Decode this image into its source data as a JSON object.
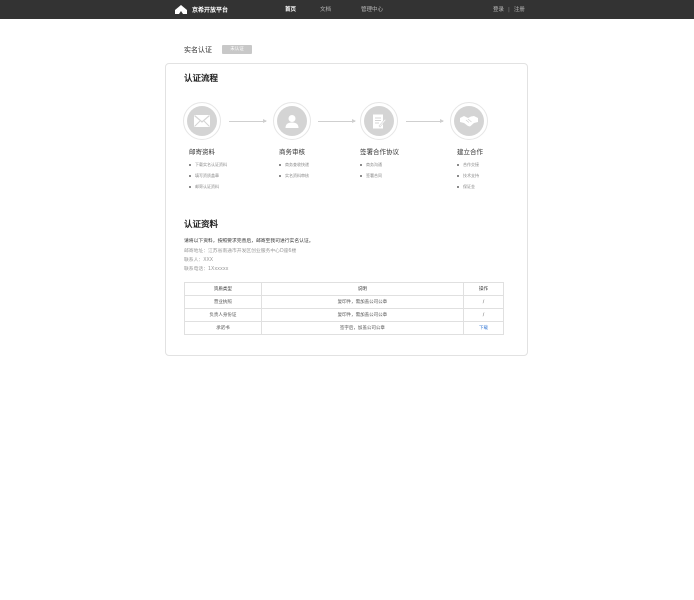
{
  "header": {
    "brand": "京希开放平台",
    "nav": [
      "首页",
      "文档",
      "管理中心"
    ],
    "active_nav": "首页",
    "login": "登录",
    "register": "注册"
  },
  "page": {
    "title": "实名认证",
    "status": "未认证"
  },
  "process": {
    "title": "认证流程",
    "steps": [
      {
        "title": "邮寄资料",
        "icon": "envelope-icon",
        "items": [
          "下载实名认证资料",
          "填写资质盖章",
          "邮寄认证资料"
        ]
      },
      {
        "title": "商务审核",
        "icon": "user-icon",
        "items": [
          "商务查收快递",
          "实名资料审核"
        ]
      },
      {
        "title": "签署合作协议",
        "icon": "contract-icon",
        "items": [
          "商务沟通",
          "签署合同"
        ]
      },
      {
        "title": "建立合作",
        "icon": "handshake-icon",
        "items": [
          "合作交接",
          "技术支持",
          "保证金"
        ]
      }
    ]
  },
  "materials": {
    "title": "认证资料",
    "intro": "请将以下资料，按照要求完善后，邮寄至我司进行实名认证。",
    "address": "邮寄地址：江苏省南通市开发区创业服务中心D座6楼",
    "contact": "联系人：XXX",
    "phone": "联系电话：1Xxxxxx",
    "table": {
      "headers": [
        "资质类型",
        "说明",
        "操作"
      ],
      "rows": [
        [
          "营业执照",
          "复印件，需加盖公司公章",
          "/"
        ],
        [
          "负责人身份证",
          "复印件，需加盖公司公章",
          "/"
        ],
        [
          "承诺书",
          "签字后，加盖公司公章",
          "下载"
        ]
      ]
    }
  },
  "colors": {
    "topbar": "#333333",
    "badge": "#c8c8c8",
    "icon_circle": "#d4d4d4",
    "link": "#3a7bd5"
  }
}
